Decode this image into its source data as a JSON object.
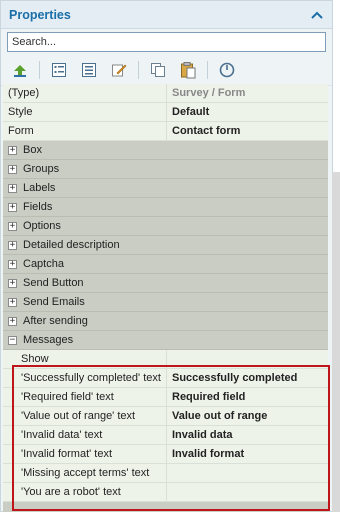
{
  "panel": {
    "title": "Properties",
    "collapse_icon": "chevron-up-icon"
  },
  "search": {
    "placeholder": "Search...",
    "value": ""
  },
  "toolbar": {
    "buttons": [
      "tree-add-icon",
      "categorized-view-icon",
      "list-view-icon",
      "edit-icon",
      "copy-icon",
      "paste-icon",
      "reset-icon"
    ]
  },
  "properties": {
    "type": {
      "label": "(Type)",
      "value": "Survey / Form"
    },
    "style": {
      "label": "Style",
      "value": "Default"
    },
    "form": {
      "label": "Form",
      "value": "Contact form"
    },
    "groups": [
      "Box",
      "Groups",
      "Labels",
      "Fields",
      "Options",
      "Detailed description",
      "Captcha",
      "Send Button",
      "Send Emails",
      "After sending",
      "Messages"
    ],
    "messages": [
      {
        "label": "Show",
        "value": ""
      },
      {
        "label": "'Successfully completed' text",
        "value": "Successfully completed"
      },
      {
        "label": "'Required field' text",
        "value": "Required field"
      },
      {
        "label": "'Value out of range' text",
        "value": "Value out of range"
      },
      {
        "label": "'Invalid data' text",
        "value": "Invalid data"
      },
      {
        "label": "'Invalid format' text",
        "value": "Invalid format"
      },
      {
        "label": "'Missing accept terms' text",
        "value": ""
      },
      {
        "label": "'You are a robot' text",
        "value": ""
      }
    ]
  },
  "colors": {
    "header_text": "#1b6fa8",
    "group_row": "#c9cdc4",
    "highlight": "#c0141b"
  }
}
